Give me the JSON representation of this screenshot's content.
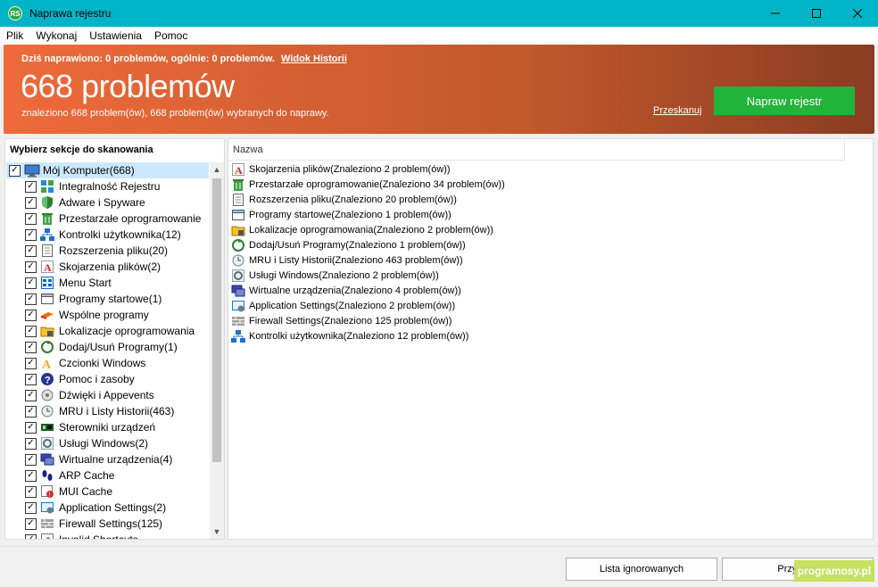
{
  "window": {
    "title": "Naprawa rejestru",
    "icon_text": "RS"
  },
  "menu": [
    "Plik",
    "Wykonaj",
    "Ustawienia",
    "Pomoc"
  ],
  "banner": {
    "today_text": "Dziś naprawiono: 0 problemów, ogólnie: 0 problemów.",
    "history_link": "Widok Historii",
    "headline": "668 problemów",
    "subline": "znaleziono 668 problem(ów), 668 problem(ów) wybranych do naprawy.",
    "rescan_link": "Przeskanuj",
    "fix_button": "Napraw rejestr",
    "fix_color": "#22b33a"
  },
  "left": {
    "header": "Wybierz sekcje do skanowania",
    "root": {
      "label": "Mój Komputer(668)",
      "icon": "computer-icon"
    },
    "items": [
      {
        "label": "Integralność Rejestru",
        "icon": "registry-icon"
      },
      {
        "label": "Adware i Spyware",
        "icon": "shield-icon"
      },
      {
        "label": "Przestarzałe oprogramowanie",
        "icon": "trash-icon"
      },
      {
        "label": "Kontrolki użytkownika(12)",
        "icon": "network-icon"
      },
      {
        "label": "Rozszerzenia pliku(20)",
        "icon": "file-icon"
      },
      {
        "label": "Skojarzenia plików(2)",
        "icon": "letter-a-icon"
      },
      {
        "label": "Menu Start",
        "icon": "menu-icon"
      },
      {
        "label": "Programy startowe(1)",
        "icon": "window-icon"
      },
      {
        "label": "Wspólne programy",
        "icon": "shared-icon"
      },
      {
        "label": "Lokalizacje oprogramowania",
        "icon": "folder-icon"
      },
      {
        "label": "Dodaj/Usuń Programy(1)",
        "icon": "recycle-icon"
      },
      {
        "label": "Czcionki Windows",
        "icon": "font-icon"
      },
      {
        "label": "Pomoc i zasoby",
        "icon": "help-icon"
      },
      {
        "label": "Dźwięki i Appevents",
        "icon": "sound-icon"
      },
      {
        "label": "MRU i Listy Historii(463)",
        "icon": "history-icon"
      },
      {
        "label": "Sterowniki urządzeń",
        "icon": "driver-icon"
      },
      {
        "label": "Usługi Windows(2)",
        "icon": "service-icon"
      },
      {
        "label": "Wirtualne urządzenia(4)",
        "icon": "virtual-device-icon"
      },
      {
        "label": "ARP Cache",
        "icon": "footprints-icon"
      },
      {
        "label": "MUI Cache",
        "icon": "cache-icon"
      },
      {
        "label": "Application Settings(2)",
        "icon": "settings-icon"
      },
      {
        "label": "Firewall Settings(125)",
        "icon": "firewall-icon"
      },
      {
        "label": "Invalid Shortcuts",
        "icon": "shortcut-icon"
      }
    ]
  },
  "right": {
    "column_header": "Nazwa",
    "results": [
      {
        "label": "Skojarzenia plików(Znaleziono 2 problem(ów))",
        "icon": "letter-a-icon"
      },
      {
        "label": "Przestarzałe oprogramowanie(Znaleziono 34 problem(ów))",
        "icon": "trash-icon"
      },
      {
        "label": "Rozszerzenia pliku(Znaleziono 20 problem(ów))",
        "icon": "file-icon"
      },
      {
        "label": "Programy startowe(Znaleziono 1 problem(ów))",
        "icon": "window-icon"
      },
      {
        "label": "Lokalizacje oprogramowania(Znaleziono 2 problem(ów))",
        "icon": "folder-icon"
      },
      {
        "label": "Dodaj/Usuń Programy(Znaleziono 1 problem(ów))",
        "icon": "recycle-icon"
      },
      {
        "label": "MRU i Listy Historii(Znaleziono 463 problem(ów))",
        "icon": "history-icon"
      },
      {
        "label": "Usługi Windows(Znaleziono 2 problem(ów))",
        "icon": "service-icon"
      },
      {
        "label": "Wirtualne urządzenia(Znaleziono 4 problem(ów))",
        "icon": "virtual-device-icon"
      },
      {
        "label": "Application Settings(Znaleziono 2 problem(ów))",
        "icon": "settings-icon"
      },
      {
        "label": "Firewall Settings(Znaleziono 125 problem(ów))",
        "icon": "firewall-icon"
      },
      {
        "label": "Kontrolki użytkownika(Znaleziono 12 problem(ów))",
        "icon": "network-icon"
      }
    ]
  },
  "bottom": {
    "ignored_button": "Lista ignorowanych",
    "restore_button": "Przywróć",
    "watermark": "programosy.pl"
  }
}
